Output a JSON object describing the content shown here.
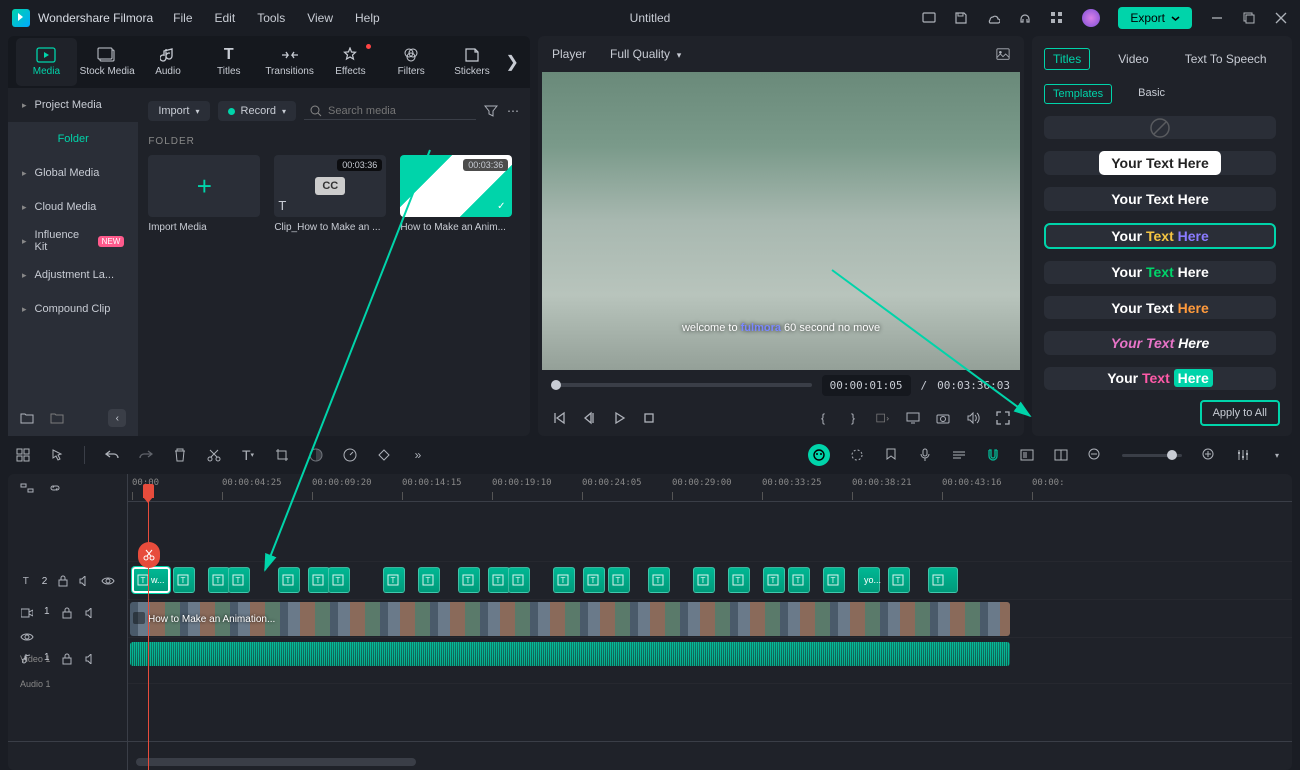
{
  "app": {
    "name": "Wondershare Filmora",
    "document": "Untitled"
  },
  "menu": [
    "File",
    "Edit",
    "Tools",
    "View",
    "Help"
  ],
  "export_label": "Export",
  "mainTabs": [
    {
      "label": "Media",
      "icon": "media"
    },
    {
      "label": "Stock Media",
      "icon": "stock"
    },
    {
      "label": "Audio",
      "icon": "audio"
    },
    {
      "label": "Titles",
      "icon": "titles"
    },
    {
      "label": "Transitions",
      "icon": "transitions"
    },
    {
      "label": "Effects",
      "icon": "effects",
      "dot": true
    },
    {
      "label": "Filters",
      "icon": "filters"
    },
    {
      "label": "Stickers",
      "icon": "stickers"
    }
  ],
  "sidebar": {
    "items": [
      {
        "label": "Project Media",
        "selected": true
      },
      {
        "label": "Folder",
        "folder": true
      },
      {
        "label": "Global Media"
      },
      {
        "label": "Cloud Media"
      },
      {
        "label": "Influence Kit",
        "new": true
      },
      {
        "label": "Adjustment La..."
      },
      {
        "label": "Compound Clip"
      }
    ]
  },
  "mediaToolbar": {
    "import": "Import",
    "record": "Record",
    "search_placeholder": "Search media"
  },
  "folder_header": "FOLDER",
  "mediaCards": [
    {
      "type": "import",
      "label": "Import Media"
    },
    {
      "type": "cc",
      "duration": "00:03:36",
      "label": "Clip_How to Make an ..."
    },
    {
      "type": "anim",
      "duration": "00:03:36",
      "label": "How to Make an Anim..."
    }
  ],
  "preview": {
    "player_label": "Player",
    "quality": "Full Quality",
    "caption_pre": "welcome to ",
    "caption_brand": "fulmora ",
    "caption_post": "60 second no move",
    "time_current": "00:00:01:05",
    "time_sep": "/",
    "time_total": "00:03:36:03"
  },
  "rightPanel": {
    "tabs": [
      "Titles",
      "Video",
      "Text To Speech"
    ],
    "subtabs": [
      "Templates",
      "Basic"
    ],
    "apply_label": "Apply to All",
    "templates": [
      {
        "kind": "none"
      },
      {
        "kind": "pill",
        "t1": "Your Text",
        "t2": " Here",
        "c1": "#222",
        "c2": "#222",
        "bg": "#fff"
      },
      {
        "kind": "plain",
        "t1": "Your Text ",
        "t2": "Here",
        "c1": "#fff",
        "c2": "#fff"
      },
      {
        "kind": "tricolor",
        "selected": true,
        "t1": "Your ",
        "t2": "Text ",
        "t3": "Here",
        "c1": "#fff",
        "c2": "#f5c542",
        "c3": "#8a7bff"
      },
      {
        "kind": "tricolor",
        "t1": "Your ",
        "t2": "Text ",
        "t3": "Here",
        "c1": "#fff",
        "c2": "#00d46a",
        "c3": "#fff"
      },
      {
        "kind": "plain",
        "t1": "Your Text ",
        "t2": "Here",
        "c1": "#fff",
        "c2": "#ff9a3c"
      },
      {
        "kind": "italic",
        "t1": "Your Text ",
        "t2": "Here",
        "c1": "#e874c8",
        "c2": "#fff"
      },
      {
        "kind": "box",
        "t1": "Your ",
        "t2": "Text ",
        "t3": "Here",
        "c1": "#fff",
        "c2": "#ff5aa8",
        "c3": "#fff",
        "boxc": "#00d4aa"
      }
    ]
  },
  "timeline": {
    "ticks": [
      "00:00",
      "00:00:04:25",
      "00:00:09:20",
      "00:00:14:15",
      "00:00:19:10",
      "00:00:24:05",
      "00:00:29:00",
      "00:00:33:25",
      "00:00:38:21",
      "00:00:43:16",
      "00:00:"
    ],
    "tracks": {
      "text": {
        "icon": "T",
        "num": "2"
      },
      "video": {
        "icon": "V",
        "num": "1",
        "label": "Video 1"
      },
      "audio": {
        "icon": "A",
        "num": "1",
        "label": "Audio 1"
      }
    },
    "video_clip_label": "How to Make an Animation...",
    "text_clip_first": "w...",
    "text_clip_last": "yo..."
  }
}
